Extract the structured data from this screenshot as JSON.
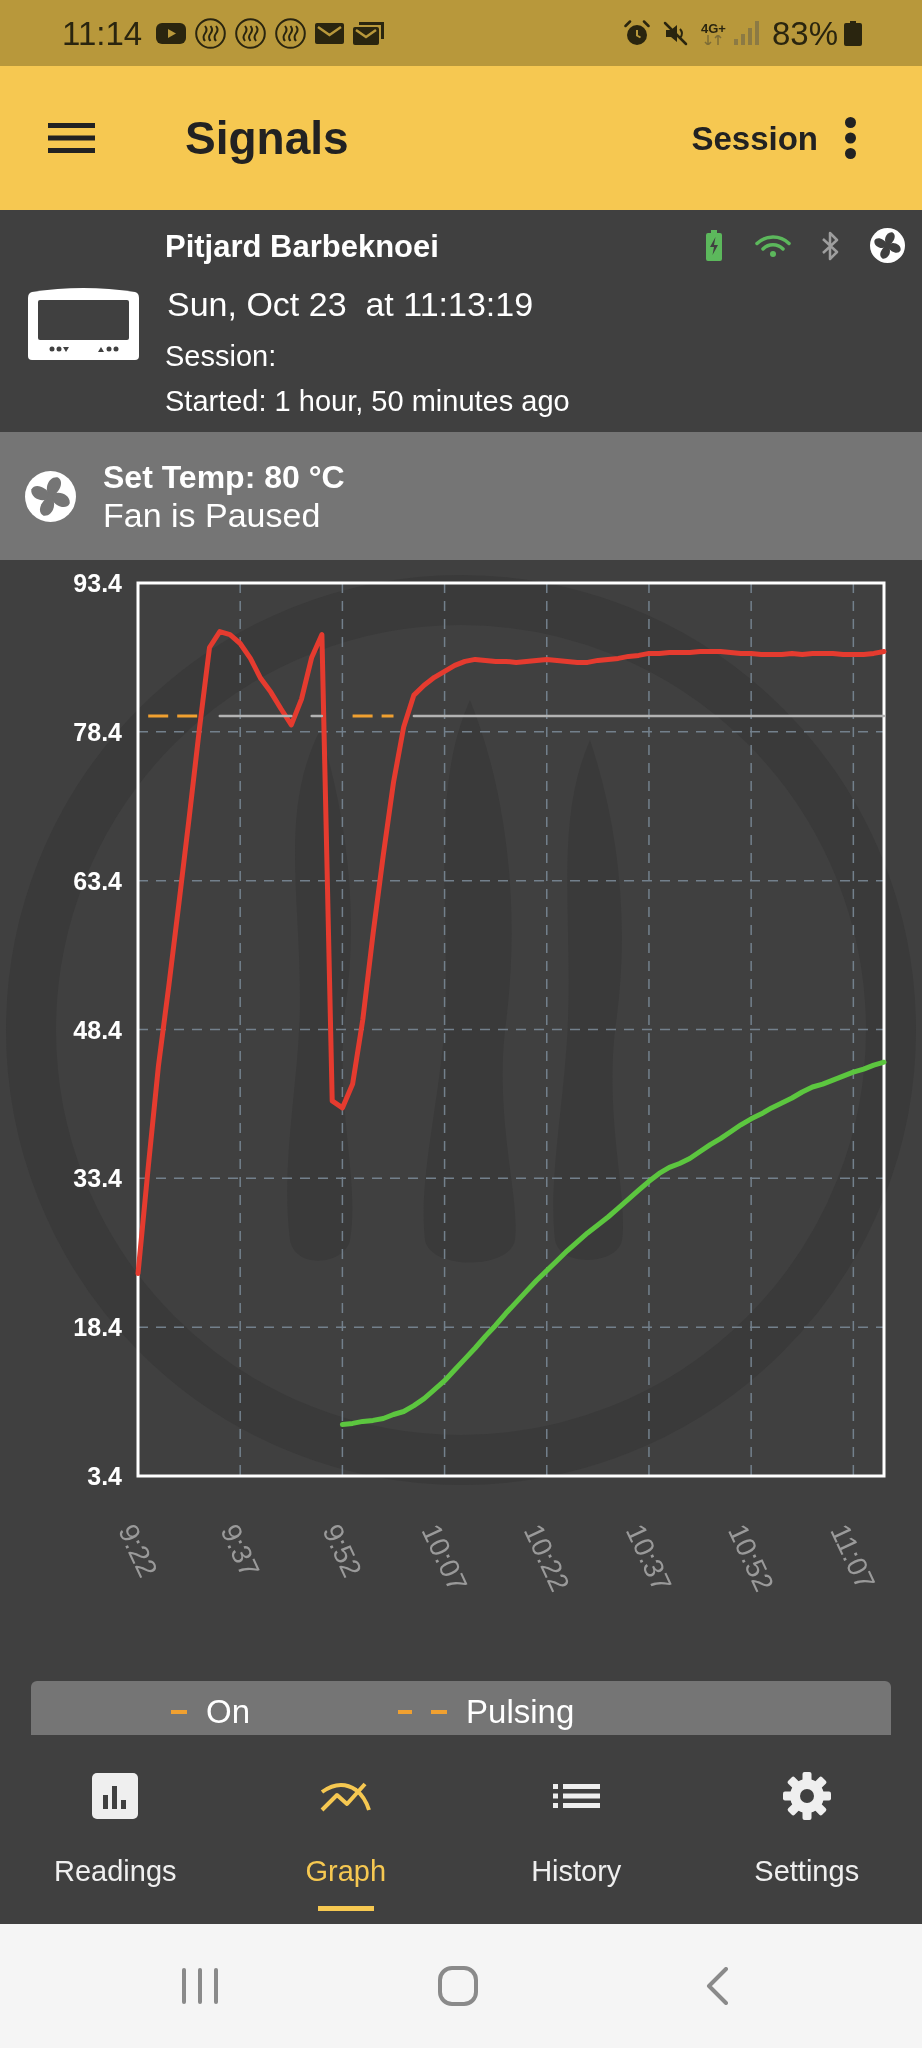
{
  "status_bar": {
    "time": "11:14",
    "network": "4G+",
    "battery": "83%"
  },
  "app_bar": {
    "title": "Signals",
    "action": "Session"
  },
  "device": {
    "name": "Pitjard Barbeknoei",
    "datetime": "Sun, Oct 23  at 11:13:19",
    "session": "Session:",
    "started": "Started: 1 hour, 50 minutes ago",
    "status_icons": [
      {
        "kind": "battery",
        "on": true
      },
      {
        "kind": "wifi",
        "on": true
      },
      {
        "kind": "bluetooth",
        "on": false
      }
    ]
  },
  "fan_panel": {
    "set_temp": "Set Temp: 80 °C",
    "fan_state": "Fan is Paused"
  },
  "graph": {
    "chart_data": {
      "type": "line",
      "grid": true,
      "categories": [
        "9:22",
        null,
        null,
        null,
        null,
        null,
        null,
        null,
        null,
        null,
        "9:37",
        null,
        null,
        null,
        null,
        null,
        null,
        null,
        null,
        null,
        "9:52",
        null,
        null,
        null,
        null,
        null,
        null,
        null,
        null,
        null,
        "10:07",
        null,
        null,
        null,
        null,
        null,
        null,
        null,
        null,
        null,
        "10:22",
        null,
        null,
        null,
        null,
        null,
        null,
        null,
        null,
        null,
        "10:37",
        null,
        null,
        null,
        null,
        null,
        null,
        null,
        null,
        null,
        "10:52",
        null,
        null,
        null,
        null,
        null,
        null,
        null,
        null,
        null,
        "11:07",
        null,
        null,
        null
      ],
      "ylim": [
        3.4,
        93.4
      ],
      "yticks": [
        3.4,
        18.4,
        33.4,
        48.4,
        63.4,
        78.4,
        93.4
      ],
      "series": [
        {
          "color": "#e53b2f",
          "values": [
            23.8,
            34.5,
            44.7,
            52.7,
            61.1,
            69.7,
            78.6,
            86.9,
            88.5,
            88.2,
            87.3,
            85.8,
            83.8,
            82.4,
            80.7,
            79.1,
            81.7,
            85.9,
            88.2,
            41.2,
            40.5,
            42.9,
            49.4,
            58.0,
            66.0,
            73.3,
            78.9,
            82.1,
            83.1,
            83.9,
            84.5,
            85.1,
            85.5,
            85.7,
            85.6,
            85.5,
            85.5,
            85.4,
            85.5,
            85.6,
            85.7,
            85.6,
            85.5,
            85.4,
            85.4,
            85.6,
            85.7,
            85.8,
            86.0,
            86.1,
            86.3,
            86.3,
            86.4,
            86.4,
            86.4,
            86.5,
            86.5,
            86.5,
            86.4,
            86.3,
            86.3,
            86.2,
            86.2,
            86.2,
            86.3,
            86.2,
            86.3,
            86.3,
            86.3,
            86.2,
            86.2,
            86.2,
            86.3,
            86.5
          ]
        },
        {
          "color": "#5cc63f",
          "values": [
            null,
            null,
            null,
            null,
            null,
            null,
            null,
            null,
            null,
            null,
            null,
            null,
            null,
            null,
            null,
            null,
            null,
            null,
            null,
            null,
            8.6,
            8.7,
            8.9,
            9.0,
            9.2,
            9.6,
            9.9,
            10.5,
            11.2,
            12.1,
            13.0,
            14.1,
            15.2,
            16.3,
            17.5,
            18.6,
            19.8,
            20.9,
            22.0,
            23.1,
            24.1,
            25.1,
            26.1,
            27.0,
            27.9,
            28.7,
            29.5,
            30.4,
            31.3,
            32.2,
            33.1,
            33.9,
            34.5,
            34.9,
            35.4,
            36.1,
            36.8,
            37.4,
            38.1,
            38.8,
            39.4,
            39.9,
            40.5,
            41.0,
            41.5,
            42.1,
            42.6,
            42.9,
            43.3,
            43.7,
            44.1,
            44.4,
            44.8,
            45.1
          ]
        },
        {
          "color": "#b3b3b3",
          "values": [
            null,
            null,
            null,
            null,
            null,
            null,
            null,
            null,
            80,
            80,
            80,
            80,
            80,
            80,
            80,
            80,
            null,
            80,
            80,
            null,
            null,
            null,
            null,
            null,
            null,
            null,
            null,
            80,
            80,
            80,
            80,
            80,
            80,
            80,
            80,
            80,
            80,
            80,
            80,
            80,
            80,
            80,
            80,
            80,
            80,
            80,
            80,
            80,
            80,
            80,
            80,
            80,
            80,
            80,
            80,
            80,
            80,
            80,
            80,
            80,
            80,
            80,
            80,
            80,
            80,
            80,
            80,
            80,
            80,
            80,
            80,
            80,
            80,
            80
          ]
        },
        {
          "color": "#f0a030",
          "line_style": "dashed",
          "values": [
            null,
            80,
            80,
            80,
            80,
            80,
            80,
            null,
            null,
            null,
            null,
            null,
            null,
            null,
            null,
            null,
            null,
            null,
            null,
            null,
            null,
            80,
            80,
            80,
            80,
            80,
            null,
            null,
            null,
            null,
            null,
            null,
            null,
            null,
            null,
            null,
            null,
            null,
            null,
            null,
            null,
            null,
            null,
            null,
            null,
            null,
            null,
            null,
            null,
            null,
            null,
            null,
            null,
            null,
            null,
            null,
            null,
            null,
            null,
            null,
            null,
            null,
            null,
            null,
            null,
            null,
            null,
            null,
            null,
            null,
            null,
            null,
            null,
            null
          ]
        }
      ]
    }
  },
  "legend": [
    {
      "kind": "on",
      "label": "On"
    },
    {
      "kind": "pulsing",
      "label": "Pulsing"
    }
  ],
  "nav": [
    {
      "kind": "readings",
      "label": "Readings",
      "selected": false
    },
    {
      "kind": "graph",
      "label": "Graph",
      "selected": true
    },
    {
      "kind": "history",
      "label": "History",
      "selected": false
    },
    {
      "kind": "settings",
      "label": "Settings",
      "selected": false
    }
  ]
}
